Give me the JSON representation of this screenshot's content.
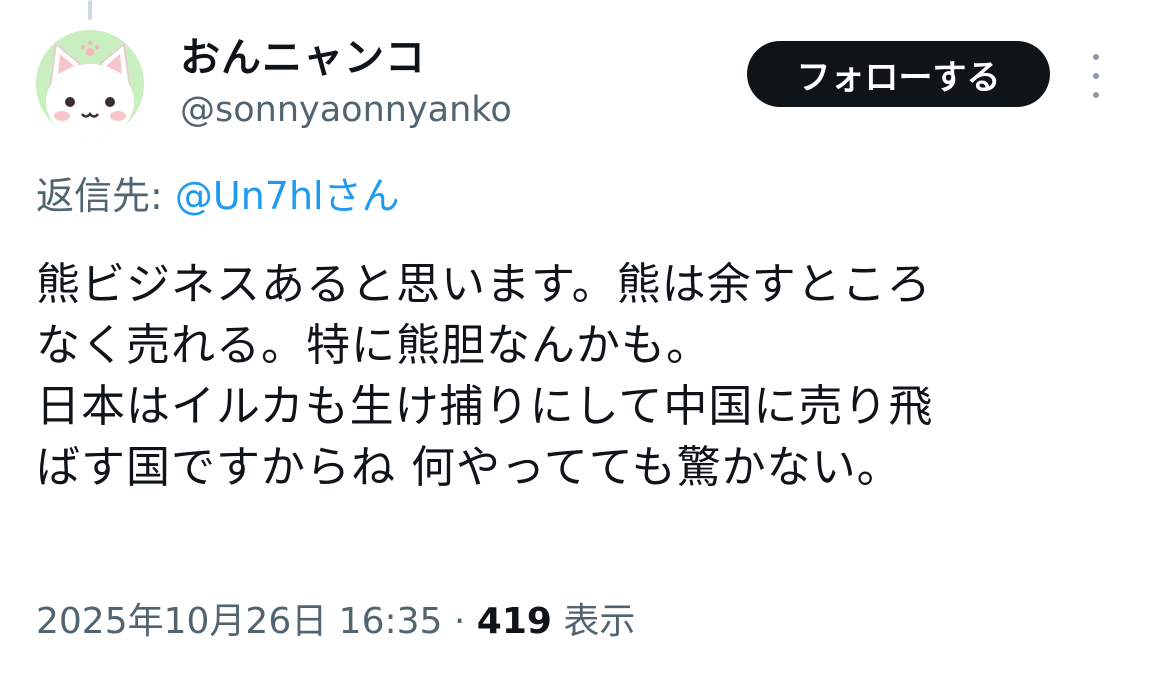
{
  "user": {
    "display_name": "おんニャンコ",
    "handle": "@sonnyaonnyanko",
    "avatar_icon": "cat-avatar-icon"
  },
  "actions": {
    "follow_label": "フォローする",
    "more_icon": "more-vertical-icon"
  },
  "reply": {
    "prefix": "返信先: ",
    "mention": "@Un7hlさん"
  },
  "tweet": {
    "lines": [
      "熊ビジネスあると思います。熊は余すところ",
      "なく売れる。特に熊胆なんかも。",
      "日本はイルカも生け捕りにして中国に売り飛",
      "ばす国ですからね 何やってても驚かない。"
    ]
  },
  "meta": {
    "timestamp": "2025年10月26日 16:35",
    "separator": " · ",
    "views_count": "419",
    "views_label": " 表示"
  },
  "colors": {
    "text": "#0f1419",
    "secondary": "#536471",
    "link": "#1d9bf0",
    "avatar_bg": "#c9efc1"
  }
}
